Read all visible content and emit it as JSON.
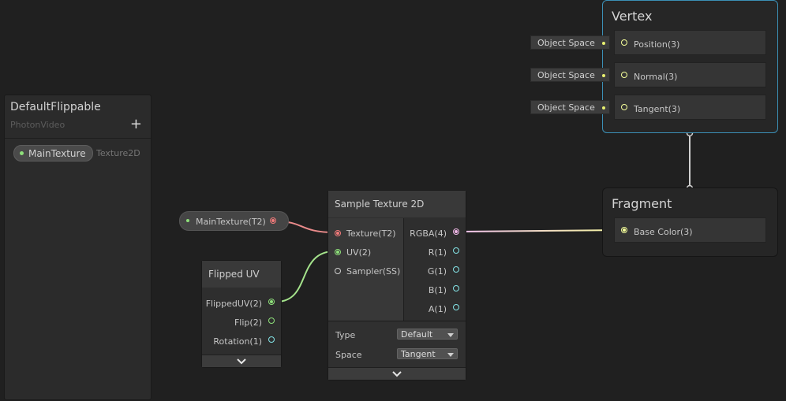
{
  "blackboard": {
    "title": "DefaultFlippable",
    "subtitle": "PhotonVideo",
    "add_label": "+",
    "properties": [
      {
        "name": "MainTexture",
        "type": "Texture2D"
      }
    ]
  },
  "property_node": {
    "label": "MainTexture(T2)"
  },
  "sample_texture": {
    "title": "Sample Texture 2D",
    "inputs": [
      "Texture(T2)",
      "UV(2)",
      "Sampler(SS)"
    ],
    "outputs": [
      "RGBA(4)",
      "R(1)",
      "G(1)",
      "B(1)",
      "A(1)"
    ],
    "options": [
      {
        "label": "Type",
        "value": "Default"
      },
      {
        "label": "Space",
        "value": "Tangent"
      }
    ],
    "expand_icon": "chevron-down-icon"
  },
  "flipped_uv": {
    "title": "Flipped UV",
    "outputs": [
      "FlippedUV(2)",
      "Flip(2)",
      "Rotation(1)"
    ],
    "expand_icon": "chevron-down-icon"
  },
  "vertex": {
    "title": "Vertex",
    "slots": [
      "Position(3)",
      "Normal(3)",
      "Tangent(3)"
    ],
    "default_inputs": [
      "Object Space",
      "Object Space",
      "Object Space"
    ]
  },
  "fragment": {
    "title": "Fragment",
    "slots": [
      "Base Color(3)"
    ]
  },
  "colors": {
    "background": "#202020",
    "texture_port": "#f27a7a",
    "vector2_port": "#8ee07a",
    "vector4_port": "#f0b8e8",
    "vector1_port": "#84e4e7",
    "vector3_port": "#f6ff9a",
    "selection": "#3b8fb5"
  }
}
